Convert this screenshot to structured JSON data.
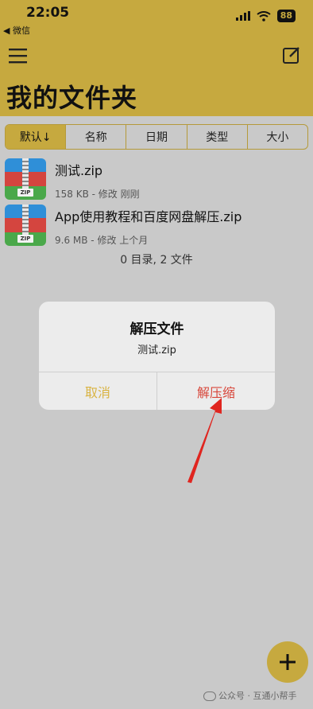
{
  "status_bar": {
    "time": "22:05",
    "back_label": "◀ 微信",
    "battery": "88"
  },
  "header": {
    "title": "我的文件夹",
    "menu_icon": "hamburger-menu-icon",
    "edit_icon": "compose-icon"
  },
  "sort_options": [
    {
      "label": "默认↓",
      "active": true
    },
    {
      "label": "名称",
      "active": false
    },
    {
      "label": "日期",
      "active": false
    },
    {
      "label": "类型",
      "active": false
    },
    {
      "label": "大小",
      "active": false
    }
  ],
  "files": [
    {
      "name": "测试.zip",
      "meta": "158 KB - 修改 刚刚",
      "icon": "zip-archive-icon",
      "icon_tag": "ZIP"
    },
    {
      "name": "App使用教程和百度网盘解压.zip",
      "meta": "9.6 MB - 修改 上个月",
      "icon": "zip-archive-icon",
      "icon_tag": "ZIP"
    }
  ],
  "summary": "0 目录, 2 文件",
  "dialog": {
    "title": "解压文件",
    "message": "测试.zip",
    "cancel_label": "取消",
    "confirm_label": "解压缩"
  },
  "fab": {
    "icon": "plus-icon",
    "label": "+"
  },
  "watermark": "公众号 · 互通小帮手",
  "colors": {
    "header": "#c6a93f",
    "background": "#c9c9c9",
    "cancel": "#d9b342",
    "confirm": "#d8473b",
    "zip_blue": "#2f8fd8",
    "zip_red": "#d4453f",
    "zip_green": "#4aa84a"
  }
}
